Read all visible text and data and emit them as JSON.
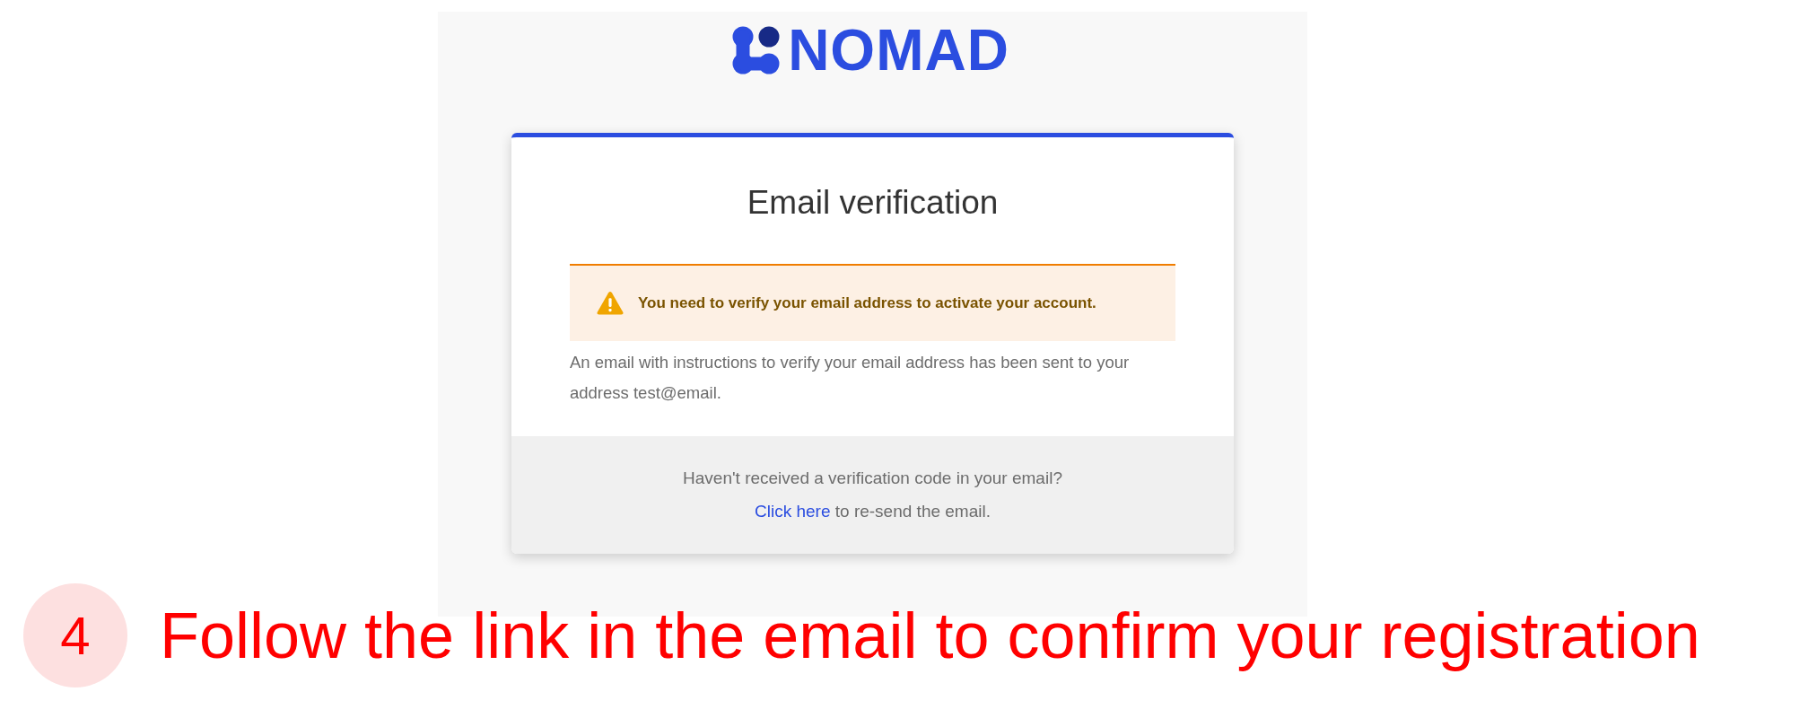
{
  "logo": {
    "wordmark": "NOMAD"
  },
  "card": {
    "title": "Email verification",
    "alert": {
      "kind": "warning",
      "message": "You need to verify your email address to activate your account."
    },
    "message": "An email with instructions to verify your email address has been sent to your address test@email.",
    "footer": {
      "question": "Haven't received a verification code in your email?",
      "link": "Click here",
      "link_suffix": " to re-send the email."
    }
  },
  "step": {
    "number": "4",
    "text": "Follow the link in the email to confirm your registration"
  }
}
